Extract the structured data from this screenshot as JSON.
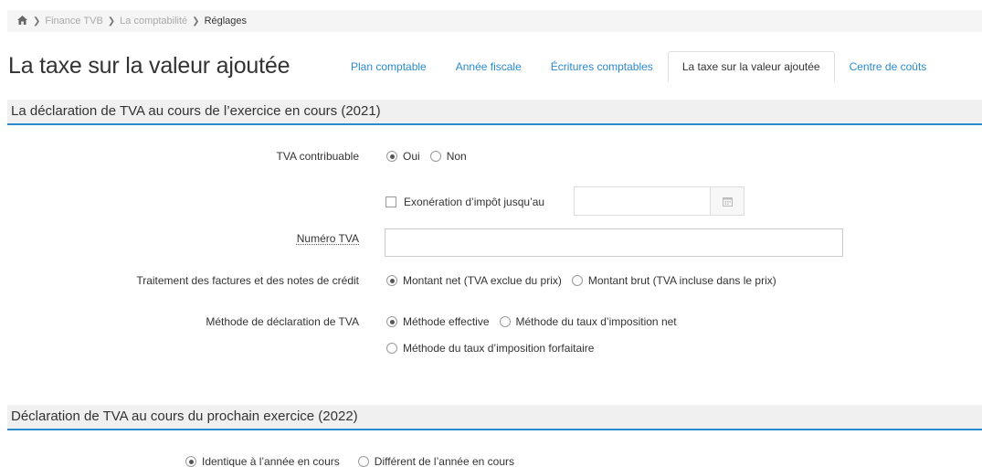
{
  "breadcrumb": {
    "items": [
      "Finance TVB",
      "La comptabilité"
    ],
    "current": "Réglages"
  },
  "page": {
    "title": "La taxe sur la valeur ajoutée"
  },
  "tabs": [
    {
      "label": "Plan comptable"
    },
    {
      "label": "Année fiscale"
    },
    {
      "label": "Écritures comptables"
    },
    {
      "label": "La taxe sur la valeur ajoutée",
      "active": true
    },
    {
      "label": "Centre de coûts"
    }
  ],
  "section1": {
    "title": "La déclaration de TVA au cours de l’exercice en cours (2021)",
    "tva_contribuable": {
      "label": "TVA contribuable",
      "options": [
        "Oui",
        "Non"
      ],
      "selected": "Oui"
    },
    "exoneration": {
      "label": "Exonération d’impôt jusqu’au",
      "checked": false,
      "value": ""
    },
    "numero_tva": {
      "label": "Numéro TVA",
      "value": ""
    },
    "traitement": {
      "label": "Traitement des factures et des notes de crédit",
      "options": [
        "Montant net (TVA exclue du prix)",
        "Montant brut (TVA incluse dans le prix)"
      ],
      "selected": "Montant net (TVA exclue du prix)"
    },
    "methode": {
      "label": "Méthode de déclaration de TVA",
      "options": [
        "Méthode effective",
        "Méthode du taux d’imposition net",
        "Méthode du taux d’imposition forfaitaire"
      ],
      "selected": "Méthode effective"
    }
  },
  "section2": {
    "title": "Déclaration de TVA au cours du prochain exercice (2022)",
    "options": [
      "Identique à l’année en cours",
      "Différent de l’année en cours"
    ],
    "selected": "Identique à l’année en cours"
  },
  "icons": {
    "home": "home-icon",
    "calendar": "calendar-icon",
    "chevron": "chevron-right-icon"
  },
  "colors": {
    "accent": "#2a8acb",
    "section_bg": "#f0f0f0",
    "breadcrumb_bg": "#f5f5f5"
  }
}
